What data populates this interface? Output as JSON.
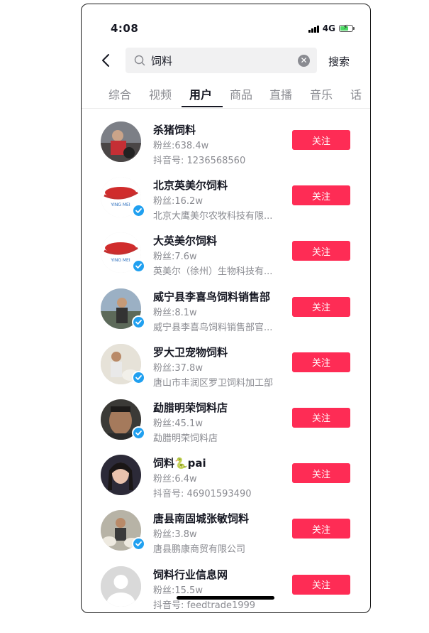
{
  "status_bar": {
    "time": "4:08",
    "network": "4G",
    "battery": 0.7
  },
  "search": {
    "query": "饲料",
    "search_button": "搜索"
  },
  "tabs": [
    {
      "label": "综合"
    },
    {
      "label": "视频"
    },
    {
      "label": "用户",
      "active": true
    },
    {
      "label": "商品"
    },
    {
      "label": "直播"
    },
    {
      "label": "音乐"
    },
    {
      "label": "话"
    }
  ],
  "users": [
    {
      "name": "杀猪饲料",
      "fans": "粉丝:638.4w",
      "sub": "抖音号: 1236568560",
      "verified": false,
      "avatar": "photo-man-motorbike",
      "follow": "关注"
    },
    {
      "name": "北京英美尔饲料",
      "fans": "粉丝:16.2w",
      "sub": "北京大鹰美尔农牧科技有限...",
      "verified": true,
      "avatar": "logo-ying-mei-er",
      "follow": "关注"
    },
    {
      "name": "大英美尔饲料",
      "fans": "粉丝:7.6w",
      "sub": "英美尔（徐州）生物科技有...",
      "verified": true,
      "avatar": "logo-ying-mei-er",
      "follow": "关注"
    },
    {
      "name": "威宁县李喜鸟饲料销售部",
      "fans": "粉丝:8.1w",
      "sub": "威宁县李喜鸟饲料销售部官...",
      "verified": true,
      "avatar": "photo-man-outdoor",
      "follow": "关注"
    },
    {
      "name": "罗大卫宠物饲料",
      "fans": "粉丝:37.8w",
      "sub": "唐山市丰润区罗卫饲料加工部",
      "verified": true,
      "avatar": "photo-man-sheep",
      "follow": "关注"
    },
    {
      "name": "勐腊明荣饲料店",
      "fans": "粉丝:45.1w",
      "sub": "勐腊明荣饲料店",
      "verified": true,
      "avatar": "photo-man-face",
      "follow": "关注"
    },
    {
      "name": "饲料🐍pai",
      "fans": "粉丝:6.4w",
      "sub": "抖音号: 46901593490",
      "verified": false,
      "avatar": "photo-woman",
      "follow": "关注"
    },
    {
      "name": "唐县南固城张敏饲料",
      "fans": "粉丝:3.8w",
      "sub": "唐县鹏康商贸有限公司",
      "verified": true,
      "avatar": "photo-man-sheep-pen",
      "follow": "关注"
    },
    {
      "name": "饲料行业信息网",
      "fans": "粉丝:15.5w",
      "sub": "抖音号: feedtrade1999",
      "verified": false,
      "avatar": "default-avatar",
      "follow": "关注"
    }
  ]
}
